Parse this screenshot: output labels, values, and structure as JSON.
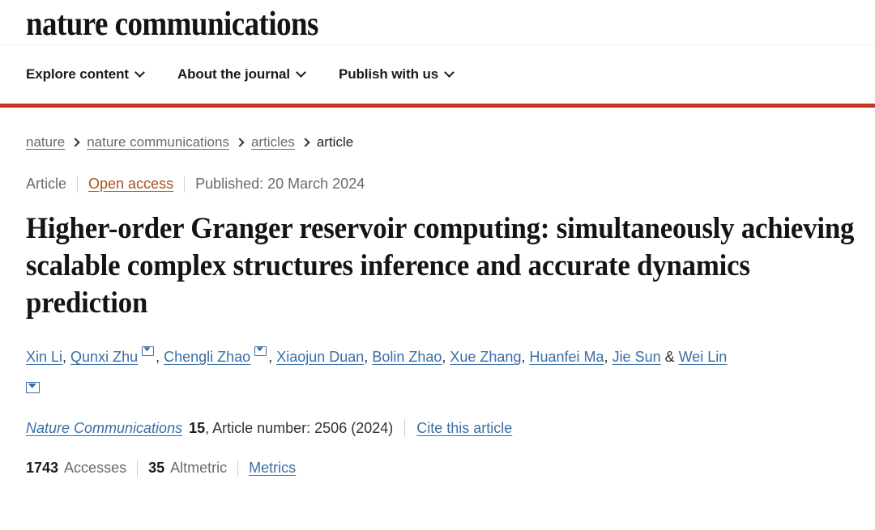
{
  "masthead": {
    "journal_name": "nature communications"
  },
  "nav": {
    "items": [
      {
        "label": "Explore content",
        "icon": "chevron-down-icon"
      },
      {
        "label": "About the journal",
        "icon": "chevron-down-icon"
      },
      {
        "label": "Publish with us",
        "icon": "chevron-down-icon"
      }
    ]
  },
  "accent_color": "#c5381f",
  "link_color": "#3b6ea5",
  "open_access_color": "#a8521c",
  "breadcrumb": {
    "items": [
      {
        "label": "nature",
        "is_link": true
      },
      {
        "label": "nature communications",
        "is_link": true
      },
      {
        "label": "articles",
        "is_link": true
      },
      {
        "label": "article",
        "is_link": false
      }
    ],
    "separator_icon": "chevron-right-icon"
  },
  "article_meta": {
    "type": "Article",
    "access": "Open access",
    "published": "Published: 20 March 2024"
  },
  "title": "Higher-order Granger reservoir computing: simultaneously achieving scalable complex structures inference and accurate dynamics prediction",
  "authors": {
    "list": [
      {
        "name": "Xin Li",
        "corresponding": false,
        "separator": ", "
      },
      {
        "name": "Qunxi Zhu",
        "corresponding": true,
        "separator": ", "
      },
      {
        "name": "Chengli Zhao",
        "corresponding": true,
        "separator": ", "
      },
      {
        "name": "Xiaojun Duan",
        "corresponding": false,
        "separator": ", "
      },
      {
        "name": "Bolin Zhao",
        "corresponding": false,
        "separator": ", "
      },
      {
        "name": "Xue Zhang",
        "corresponding": false,
        "separator": ", "
      },
      {
        "name": "Huanfei Ma",
        "corresponding": false,
        "separator": ", "
      },
      {
        "name": "Jie Sun",
        "corresponding": false,
        "separator": " & "
      },
      {
        "name": "Wei Lin",
        "corresponding": true,
        "separator": ""
      }
    ],
    "corresponding_icon": "envelope-icon"
  },
  "journal_info": {
    "journal": "Nature Communications",
    "volume": "15",
    "article_number": ", Article number: 2506 (2024)",
    "cite_label": "Cite this article"
  },
  "metrics": {
    "accesses_count": "1743",
    "accesses_label": "Accesses",
    "altmetric_count": "35",
    "altmetric_label": "Altmetric",
    "metrics_label": "Metrics"
  }
}
